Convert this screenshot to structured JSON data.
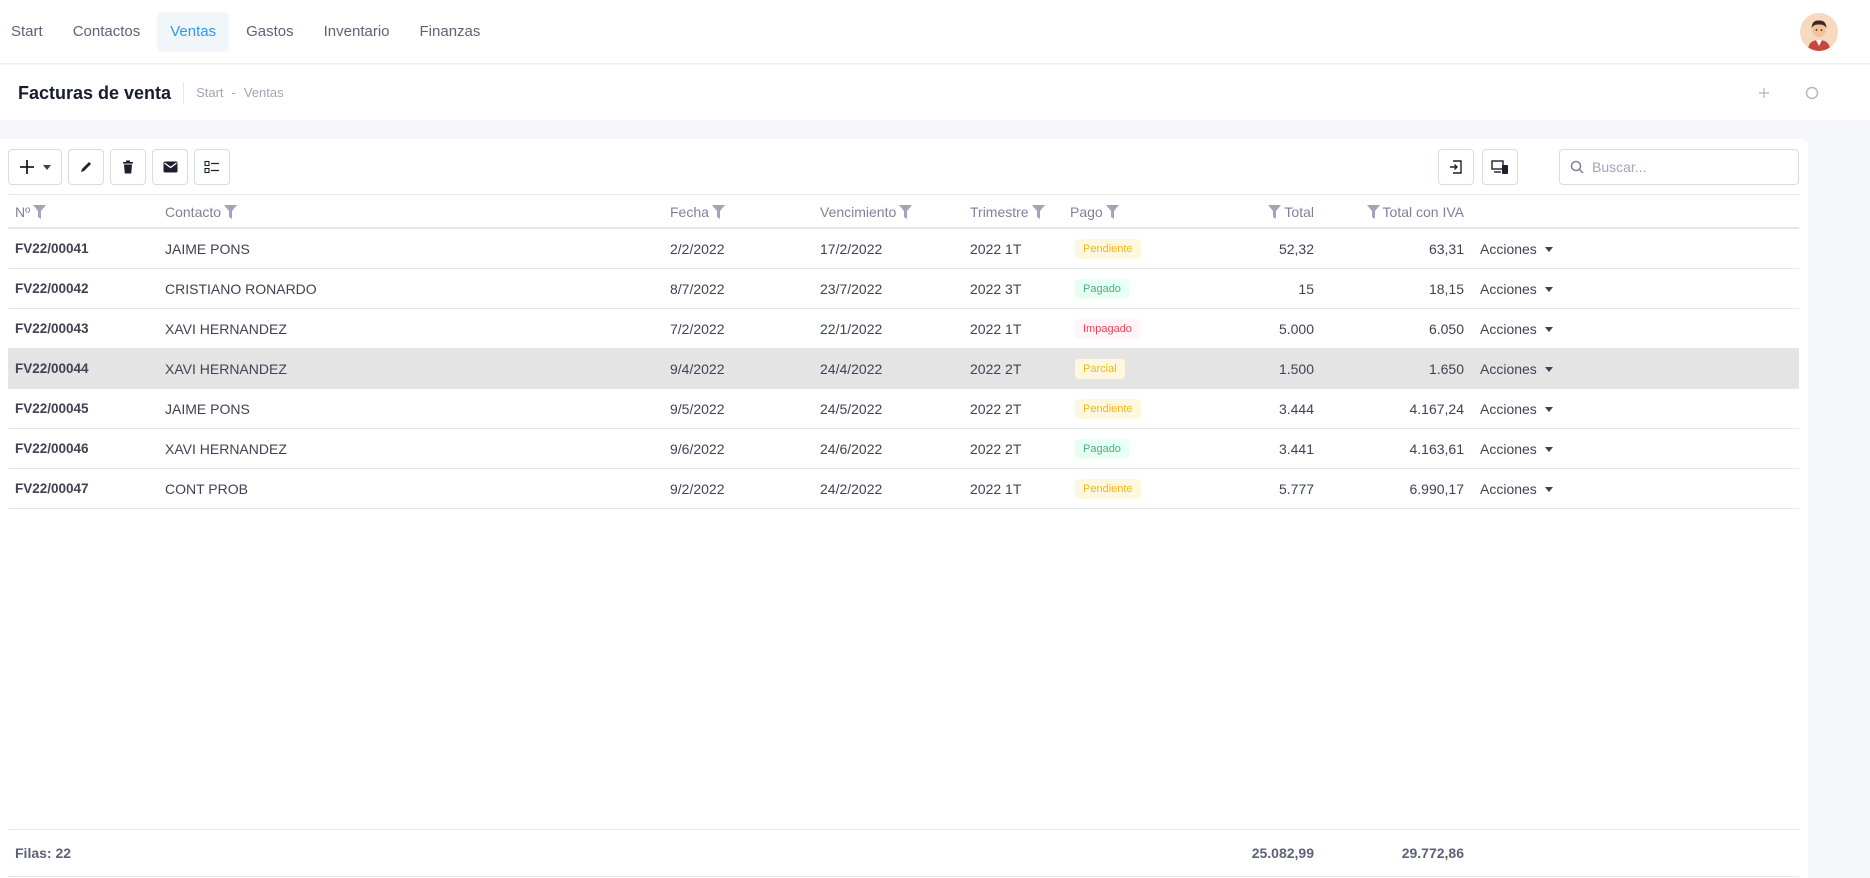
{
  "nav": {
    "items": [
      "Start",
      "Contactos",
      "Ventas",
      "Gastos",
      "Inventario",
      "Finanzas"
    ],
    "active": "Ventas"
  },
  "header": {
    "title": "Facturas de venta",
    "breadcrumb": [
      "Start",
      "-",
      "Ventas"
    ]
  },
  "search": {
    "placeholder": "Buscar..."
  },
  "table": {
    "columns": [
      "Nº",
      "Contacto",
      "Fecha",
      "Vencimiento",
      "Trimestre",
      "Pago",
      "Total",
      "Total con IVA"
    ],
    "action_label": "Acciones",
    "rows": [
      {
        "num": "FV22/00041",
        "contacto": "JAIME PONS",
        "fecha": "2/2/2022",
        "vencimiento": "17/2/2022",
        "trimestre": "2022 1T",
        "pago": "Pendiente",
        "total": "52,32",
        "total_iva": "63,31"
      },
      {
        "num": "FV22/00042",
        "contacto": "CRISTIANO RONARDO",
        "fecha": "8/7/2022",
        "vencimiento": "23/7/2022",
        "trimestre": "2022 3T",
        "pago": "Pagado",
        "total": "15",
        "total_iva": "18,15"
      },
      {
        "num": "FV22/00043",
        "contacto": "XAVI HERNANDEZ",
        "fecha": "7/2/2022",
        "vencimiento": "22/1/2022",
        "trimestre": "2022 1T",
        "pago": "Impagado",
        "total": "5.000",
        "total_iva": "6.050"
      },
      {
        "num": "FV22/00044",
        "contacto": "XAVI HERNANDEZ",
        "fecha": "9/4/2022",
        "vencimiento": "24/4/2022",
        "trimestre": "2022 2T",
        "pago": "Parcial",
        "total": "1.500",
        "total_iva": "1.650"
      },
      {
        "num": "FV22/00045",
        "contacto": "JAIME PONS",
        "fecha": "9/5/2022",
        "vencimiento": "24/5/2022",
        "trimestre": "2022 2T",
        "pago": "Pendiente",
        "total": "3.444",
        "total_iva": "4.167,24"
      },
      {
        "num": "FV22/00046",
        "contacto": "XAVI HERNANDEZ",
        "fecha": "9/6/2022",
        "vencimiento": "24/6/2022",
        "trimestre": "2022 2T",
        "pago": "Pagado",
        "total": "3.441",
        "total_iva": "4.163,61"
      },
      {
        "num": "FV22/00047",
        "contacto": "CONT PROB",
        "fecha": "9/2/2022",
        "vencimiento": "24/2/2022",
        "trimestre": "2022 1T",
        "pago": "Pendiente",
        "total": "5.777",
        "total_iva": "6.990,17"
      }
    ],
    "highlighted_row": 3,
    "footer": {
      "rows_label": "Filas: 22",
      "total": "25.082,99",
      "total_iva": "29.772,86"
    }
  },
  "badge_colors": {
    "Pendiente": {
      "bg": "#fff8dd",
      "fg": "#f1b619"
    },
    "Pagado": {
      "bg": "#e8fff3",
      "fg": "#3fb57f"
    },
    "Impagado": {
      "bg": "#fff5f8",
      "fg": "#e3445f"
    },
    "Parcial": {
      "bg": "#fff8dd",
      "fg": "#f1b619"
    }
  },
  "colors": {
    "accent": "#2f9ae0"
  }
}
